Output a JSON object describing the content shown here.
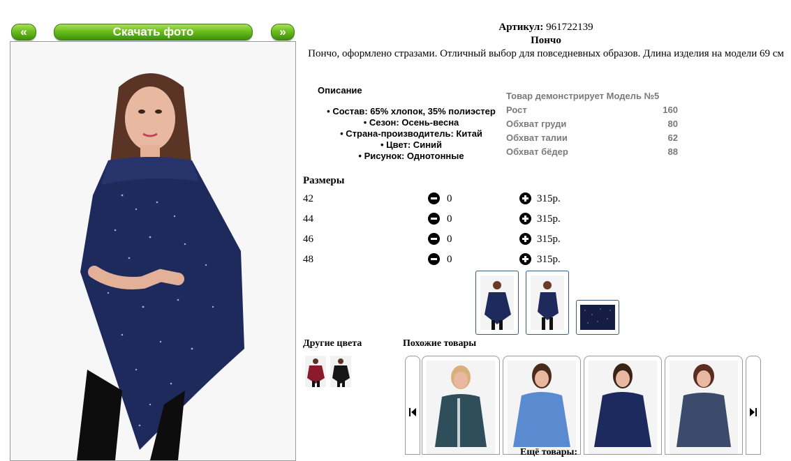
{
  "nav": {
    "prev_label": "«",
    "download_label": "Скачать фото",
    "next_label": "»"
  },
  "product": {
    "article_label": "Артикул:",
    "article_value": "961722139",
    "name": "Пончо",
    "summary": "Пончо, оформлено стразами. Отличный выбор для повседневных образов. Длина изделия на модели 69 см"
  },
  "description": {
    "title": "Описание",
    "items": [
      "Состав: 65% хлопок, 35% полиэстер",
      "Сезон: Осень-весна",
      "Страна-производитель: Китай",
      "Цвет: Синий",
      "Рисунок: Однотонные"
    ]
  },
  "model": {
    "title": "Товар демонстрирует Модель №5",
    "rows": [
      {
        "label": "Рост",
        "value": "160"
      },
      {
        "label": "Обхват груди",
        "value": "80"
      },
      {
        "label": "Обхват талии",
        "value": "62"
      },
      {
        "label": "Обхват бёдер",
        "value": "88"
      }
    ]
  },
  "sizes": {
    "title": "Размеры",
    "rows": [
      {
        "size": "42",
        "qty": "0",
        "price": "315р."
      },
      {
        "size": "44",
        "qty": "0",
        "price": "315р."
      },
      {
        "size": "46",
        "qty": "0",
        "price": "315р."
      },
      {
        "size": "48",
        "qty": "0",
        "price": "315р."
      }
    ]
  },
  "other_colors": {
    "title": "Другие цвета",
    "swatches": [
      "#8b1a2b",
      "#151515"
    ]
  },
  "similar": {
    "title": "Похожие товары"
  },
  "more": {
    "title": "Ещё товары:"
  },
  "colors": {
    "accent": "#6cbf1d",
    "garment": "#1f2a5c",
    "thumb_border": "#3d5a7a"
  }
}
